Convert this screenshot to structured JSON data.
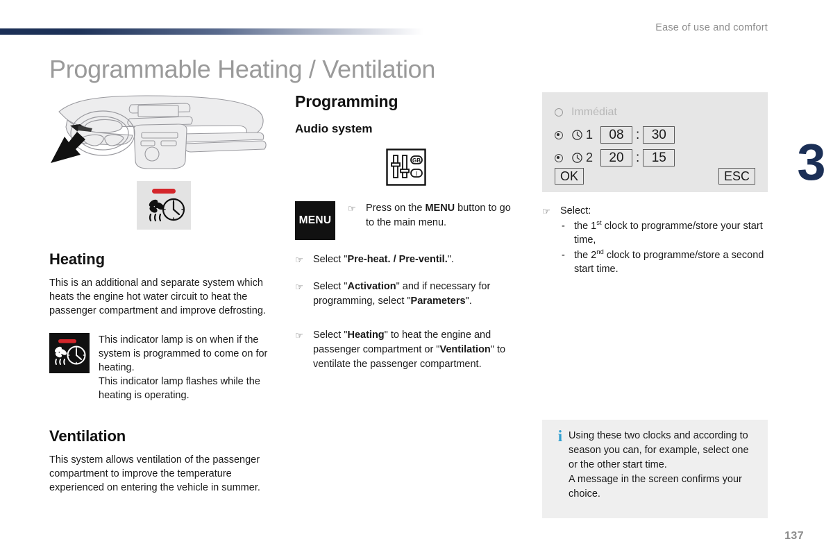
{
  "header": {
    "section_title": "Ease of use and comfort",
    "accent_color": "#1b2f56"
  },
  "chapter": {
    "number": "3"
  },
  "page": {
    "title": "Programmable Heating / Ventilation",
    "number": "137"
  },
  "left_column": {
    "dashboard_illustration_name": "dashboard-illustration",
    "control_button_icon_name": "heating-control-button-icon",
    "heating": {
      "heading": "Heating",
      "body": "This is an additional and separate system which heats the engine hot water circuit to heat the passenger compartment and improve defrosting."
    },
    "indicator_lamp": {
      "icon_name": "heating-indicator-lamp-icon",
      "line1": "This indicator lamp is on when if the system is programmed to come on for heating.",
      "line2": "This indicator lamp flashes while the heating is operating."
    },
    "ventilation": {
      "heading": "Ventilation",
      "body": "This system allows ventilation of the passenger compartment to improve the temperature experienced on entering the vehicle in summer."
    }
  },
  "mid_column": {
    "heading": "Programming",
    "subheading": "Audio system",
    "audio_icon_labels": {
      "gb": "GB",
      "i": "I"
    },
    "menu_button_label": "MENU",
    "menu_instruction": {
      "before": "Press on the ",
      "bold": "MENU",
      "after": " button to go to the main menu."
    },
    "steps": [
      {
        "p1": "Select \"",
        "b1": "Pre-heat. / Pre-ventil.",
        "p2": "\"."
      },
      {
        "p1": "Select \"",
        "b1": "Activation",
        "p2": "\" and if necessary for programming, select \"",
        "b2": "Parameters",
        "p3": "\"."
      },
      {
        "p1": "Select \"",
        "b1": "Heating",
        "p2": "\" to heat the engine and passenger compartment or \"",
        "b2": "Ventilation",
        "p3": "\" to ventilate the passenger compartment."
      }
    ]
  },
  "right_column": {
    "screen": {
      "immediate_label": "Immédiat",
      "clock1": {
        "number": "1",
        "hours": "08",
        "minutes": "30"
      },
      "clock2": {
        "number": "2",
        "hours": "20",
        "minutes": "15"
      },
      "separator": ":",
      "ok_label": "OK",
      "esc_label": "ESC"
    },
    "select": {
      "heading": "Select:",
      "dash": "-",
      "item1_pre": "the 1",
      "item1_sup": "st",
      "item1_post": " clock to programme/store your start time,",
      "item2_pre": "the 2",
      "item2_sup": "nd",
      "item2_post": " clock to programme/store a second start time."
    },
    "info_box": {
      "icon": "i",
      "accent_color": "#2f9fd0",
      "line1": "Using these two clocks and according to season you can, for example, select one or the other start time.",
      "line2": "A message in the screen confirms your choice."
    }
  }
}
